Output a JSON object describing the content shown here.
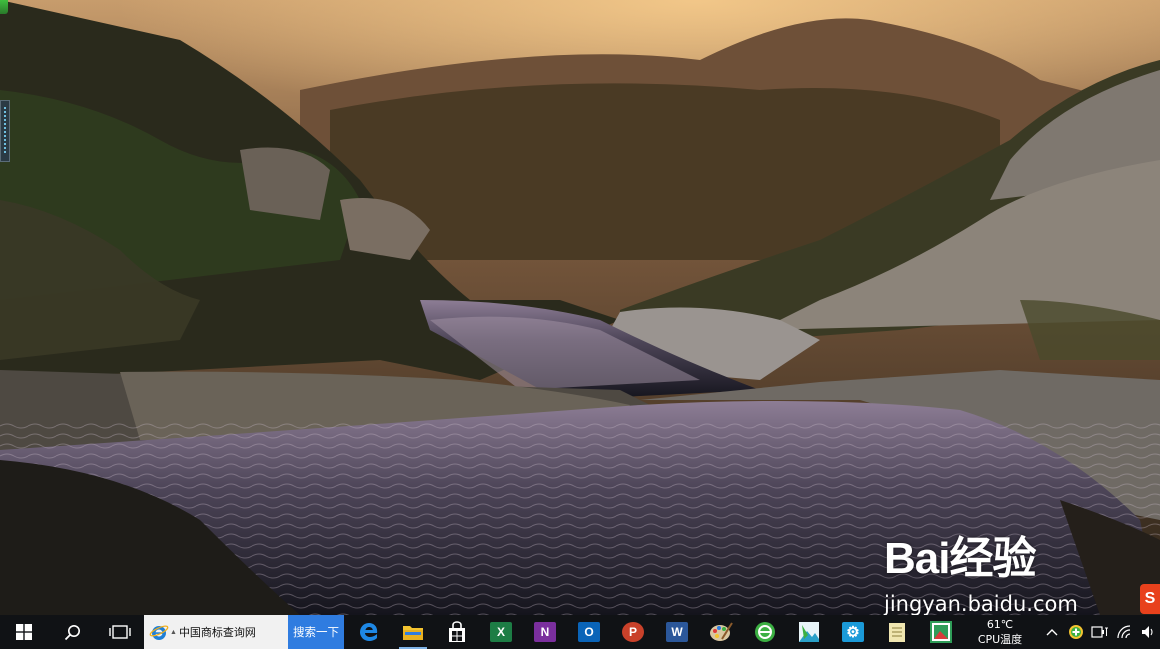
{
  "desktop": {
    "wallpaper": "sunset canyon rock pools",
    "watermark": {
      "brand": "Bai经验",
      "url": "jingyan.baidu.com"
    },
    "sogou_badge": "S"
  },
  "taskbar": {
    "start_icon": "windows-logo-icon",
    "search_icon": "magnifier-icon",
    "taskview_icon": "task-view-icon",
    "search_box": {
      "value": "中国商标查询网",
      "button": "搜索一下",
      "button_color": "#2f7ce0"
    },
    "apps": [
      {
        "name": "edge",
        "icon": "e",
        "color": "#1e88e5"
      },
      {
        "name": "file-explorer",
        "icon": "folder",
        "color": "#f4c430"
      },
      {
        "name": "store",
        "icon": "bag",
        "color": "#ffffff"
      },
      {
        "name": "excel",
        "icon": "X",
        "color": "#1d7d45"
      },
      {
        "name": "onenote",
        "icon": "N",
        "color": "#7b2f9e"
      },
      {
        "name": "outlook",
        "icon": "O",
        "color": "#0a64b8"
      },
      {
        "name": "powerpoint",
        "icon": "P",
        "color": "#c9412a"
      },
      {
        "name": "word",
        "icon": "W",
        "color": "#2b579a"
      },
      {
        "name": "paint",
        "icon": "palette",
        "color": "#d9a441"
      },
      {
        "name": "browser-360",
        "icon": "e",
        "color": "#3cb043"
      },
      {
        "name": "photos",
        "icon": "image",
        "color": "#2aa0c8"
      },
      {
        "name": "settings",
        "icon": "gear",
        "color": "#1b9ad8"
      },
      {
        "name": "notepad",
        "icon": "note",
        "color": "#f0e6b0"
      },
      {
        "name": "gallery",
        "icon": "picture",
        "color": "#2f9d58"
      }
    ],
    "tray": {
      "temp": "61℃",
      "temp_label": "CPU温度",
      "icons": [
        "chevron-up-icon",
        "green-plus-icon",
        "battery-icon",
        "wifi-icon",
        "volume-icon"
      ]
    }
  }
}
